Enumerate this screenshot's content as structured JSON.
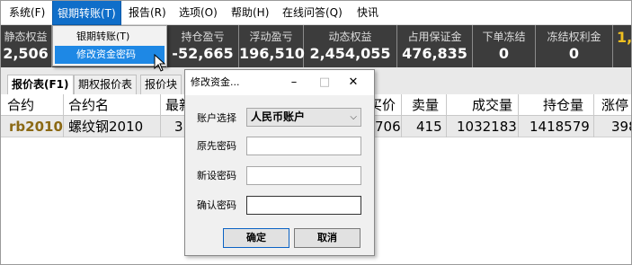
{
  "menubar": {
    "items": [
      {
        "label": "系统(F)"
      },
      {
        "label": "银期转账(T)"
      },
      {
        "label": "报告(R)"
      },
      {
        "label": "选项(O)"
      },
      {
        "label": "帮助(H)"
      },
      {
        "label": "在线问答(Q)"
      },
      {
        "label": "快讯"
      }
    ]
  },
  "dropdown": {
    "items": [
      {
        "label": "银期转账(T)"
      },
      {
        "label": "修改资金密码"
      }
    ]
  },
  "stats": [
    {
      "label": "静态权益",
      "value": "2,506"
    },
    {
      "label": "持仓盈亏",
      "value": "-52,665"
    },
    {
      "label": "浮动盈亏",
      "value": "196,510"
    },
    {
      "label": "动态权益",
      "value": "2,454,055"
    },
    {
      "label": "占用保证金",
      "value": "476,835"
    },
    {
      "label": "下单冻结",
      "value": "0"
    },
    {
      "label": "冻结权利金",
      "value": "0"
    },
    {
      "label": "",
      "value": "1,"
    }
  ],
  "tabs": [
    {
      "label": "报价表(F1)"
    },
    {
      "label": "期权报价表"
    },
    {
      "label": "报价块"
    }
  ],
  "table": {
    "headers": [
      "合约",
      "合约名",
      "最新",
      "买价",
      "卖量",
      "成交量",
      "持仓量",
      "涨停"
    ],
    "header_fragments": {
      "latest": "最新",
      "buy_price": "买价",
      "limit_up": "涨停"
    },
    "rows": [
      {
        "code": "rb2010",
        "name": "螺纹钢2010",
        "latest_fragment": "3",
        "buy_price_fragment": "706",
        "ask_volume": "415",
        "volume": "1032183",
        "open_interest": "1418579",
        "limit_up_fragment": "398"
      }
    ]
  },
  "dialog": {
    "title": "修改资金...",
    "minimize": "–",
    "maximize": "□",
    "close": "✕",
    "account_label": "账户选择",
    "account_value": "人民币账户",
    "old_pwd_label": "原先密码",
    "new_pwd_label": "新设密码",
    "confirm_pwd_label": "确认密码",
    "ok_label": "确定",
    "cancel_label": "取消"
  },
  "colors": {
    "menu_active": "#0f6ec9",
    "stats_background": "#3c3c3c",
    "code_text": "#8b6914",
    "accent_yellow": "#f0c020"
  }
}
